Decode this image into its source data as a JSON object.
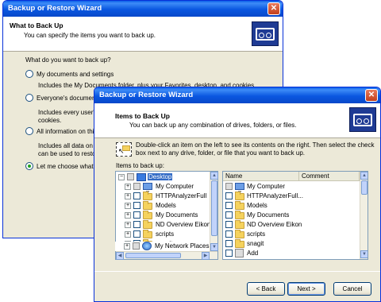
{
  "back_window": {
    "title": "Backup or Restore Wizard",
    "header_title": "What to Back Up",
    "header_subtitle": "You can specify the items you want to back up.",
    "question": "What do you want to back up?",
    "options": [
      {
        "label": "My documents and settings",
        "desc1": "Includes the My Documents folder, plus your Favorites, desktop, and cookies.",
        "selected": false
      },
      {
        "label": "Everyone's documents and settings",
        "desc1": "Includes every user's My",
        "desc2": "cookies.",
        "selected": false
      },
      {
        "label": "All information on this computer",
        "desc1": "Includes all data on this co",
        "desc2": "can be used to restore W",
        "selected": false
      },
      {
        "label": "Let me choose what to back up",
        "selected": true
      }
    ]
  },
  "front_window": {
    "title": "Backup or Restore Wizard",
    "header_title": "Items to Back Up",
    "header_subtitle": "You can back up any combination of drives, folders, or files.",
    "instruction1": "Double-click an item on the left to see its contents on the right. Then select the check",
    "instruction2": "box next to any drive, folder, or file that you want to back up.",
    "items_label": "Items to back up:",
    "tree": [
      {
        "label": "Desktop",
        "icon": "desktop-icon",
        "selected": true
      },
      {
        "label": "My Computer",
        "icon": "computer-icon"
      },
      {
        "label": "HTTPAnalyzerFull",
        "icon": "folder-icon"
      },
      {
        "label": "Models",
        "icon": "folder-icon"
      },
      {
        "label": "My Documents",
        "icon": "folder-icon"
      },
      {
        "label": "ND Overview Eikon",
        "icon": "folder-icon"
      },
      {
        "label": "scripts",
        "icon": "folder-icon"
      },
      {
        "label": "snagit",
        "icon": "folder-icon"
      },
      {
        "label": "My Network Places",
        "icon": "network-icon"
      }
    ],
    "columns": {
      "name": "Name",
      "comment": "Comment"
    },
    "list": [
      {
        "label": "My Computer",
        "icon": "computer-icon"
      },
      {
        "label": "HTTPAnalyzerFull...",
        "icon": "folder-icon"
      },
      {
        "label": "Models",
        "icon": "folder-icon"
      },
      {
        "label": "My Documents",
        "icon": "folder-icon"
      },
      {
        "label": "ND Overview Eikon",
        "icon": "folder-icon"
      },
      {
        "label": "scripts",
        "icon": "folder-icon"
      },
      {
        "label": "snagit",
        "icon": "folder-icon"
      },
      {
        "label": "Add",
        "icon": "add-icon"
      }
    ],
    "buttons": {
      "back": "< Back",
      "next": "Next >",
      "cancel": "Cancel"
    }
  }
}
